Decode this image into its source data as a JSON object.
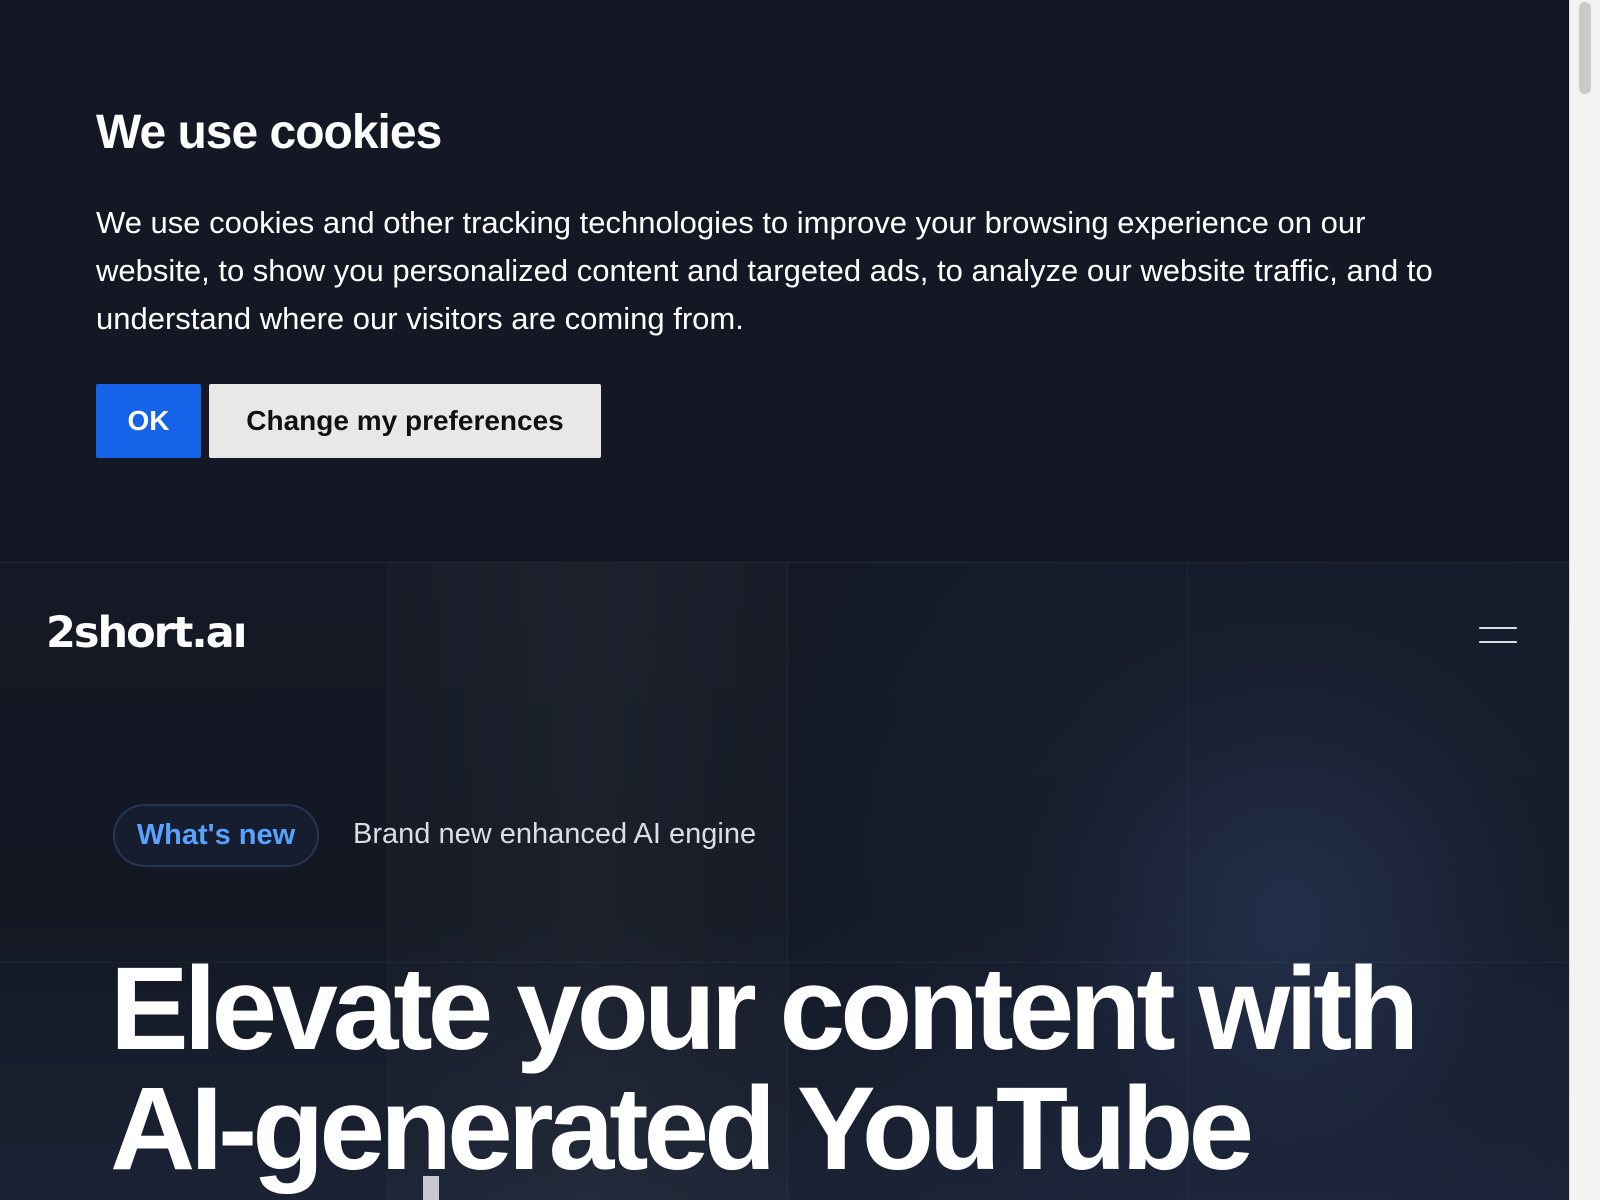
{
  "cookie_banner": {
    "title": "We use cookies",
    "message": "We use cookies and other tracking technologies to improve your browsing experience on our website, to show you personalized content and targeted ads, to analyze our website traffic, and to understand where our visitors are coming from.",
    "ok_label": "OK",
    "preferences_label": "Change my preferences",
    "primary_color": "#1563e8"
  },
  "header": {
    "logo": "2short.aı",
    "menu_icon": "menu-icon"
  },
  "hero": {
    "badge_label": "What's new",
    "announcement": "Brand new enhanced AI engine",
    "headline": "Elevate your content with AI-generated YouTube"
  },
  "colors": {
    "page_background": "#131823",
    "badge_text": "#58a3ff",
    "secondary_button": "#e8e8e8"
  }
}
